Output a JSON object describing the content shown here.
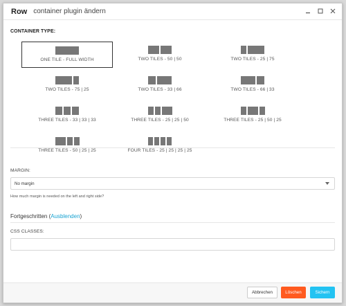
{
  "titlebar": {
    "title": "Row",
    "subtitle": "container plugin ändern"
  },
  "container": {
    "label": "CONTAINER TYPE:",
    "selected_index": 0,
    "tiles": [
      {
        "label": "ONE TILE - FULL WIDTH",
        "blocks": [
          1
        ]
      },
      {
        "label": "TWO TILES - 50 | 50",
        "blocks": [
          0.5,
          0.5
        ]
      },
      {
        "label": "TWO TILES - 25 | 75",
        "blocks": [
          0.25,
          0.75
        ]
      },
      {
        "label": "TWO TILES - 75 | 25",
        "blocks": [
          0.75,
          0.25
        ]
      },
      {
        "label": "TWO TILES - 33 | 66",
        "blocks": [
          0.33,
          0.66
        ]
      },
      {
        "label": "TWO TILES - 66 | 33",
        "blocks": [
          0.66,
          0.33
        ]
      },
      {
        "label": "THREE TILES - 33 | 33 | 33",
        "blocks": [
          0.33,
          0.33,
          0.33
        ]
      },
      {
        "label": "THREE TILES - 25 | 25 | 50",
        "blocks": [
          0.25,
          0.25,
          0.5
        ]
      },
      {
        "label": "THREE TILES - 25 | 50 | 25",
        "blocks": [
          0.25,
          0.5,
          0.25
        ]
      },
      {
        "label": "THREE TILES - 50 | 25 | 25",
        "blocks": [
          0.5,
          0.25,
          0.25
        ]
      },
      {
        "label": "FOUR TILES - 25 | 25 | 25 | 25",
        "blocks": [
          0.25,
          0.25,
          0.25,
          0.25
        ]
      }
    ]
  },
  "margin": {
    "label": "MARGIN:",
    "value": "No margin",
    "help": "How much margin is needed on the left and right side?"
  },
  "advanced": {
    "label": "Fortgeschritten",
    "toggle": "Ausblenden"
  },
  "css_classes": {
    "label": "CSS CLASSES:",
    "value": ""
  },
  "footer": {
    "cancel": "Abbrechen",
    "delete": "Löschen",
    "save": "Sichern"
  },
  "colors": {
    "accent": "#23c3f2",
    "danger": "#ff5a1f",
    "link": "#19a3d1",
    "tile_block": "#777777"
  }
}
